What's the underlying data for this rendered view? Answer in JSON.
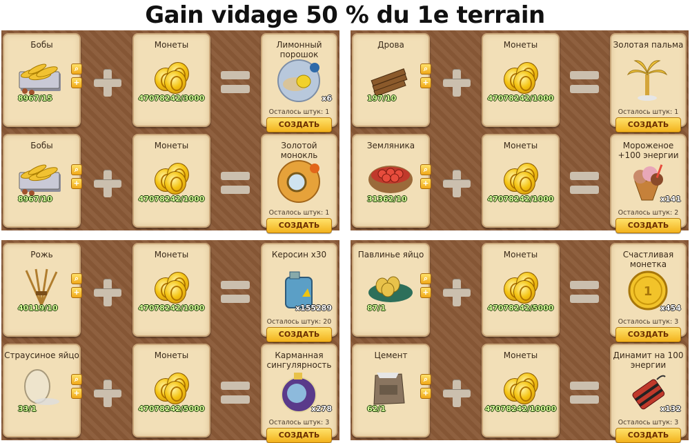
{
  "title": "Gain vidage 50 % du 1e terrain",
  "button_label": "СОЗДАТЬ",
  "panels": [
    {
      "rows": [
        {
          "ingredient": {
            "name": "Бобы",
            "count": "8967/15",
            "icon": "beans-icon"
          },
          "coins": {
            "name": "Монеты",
            "count": "47078242/3000"
          },
          "result": {
            "name": "Лимонный порошок",
            "remaining": "Осталось штук: 1",
            "qty": "x6",
            "icon": "lemon-powder-icon"
          }
        },
        {
          "ingredient": {
            "name": "Бобы",
            "count": "8967/10",
            "icon": "beans-icon"
          },
          "coins": {
            "name": "Монеты",
            "count": "47078242/1000"
          },
          "result": {
            "name": "Золотой монокль",
            "remaining": "Осталось штук: 1",
            "qty": "",
            "icon": "gold-monocle-icon"
          }
        }
      ]
    },
    {
      "rows": [
        {
          "ingredient": {
            "name": "Дрова",
            "count": "197/10",
            "icon": "firewood-icon"
          },
          "coins": {
            "name": "Монеты",
            "count": "47078242/1000"
          },
          "result": {
            "name": "Золотая пальма",
            "remaining": "Осталось штук: 1",
            "qty": "",
            "icon": "golden-palm-icon"
          }
        },
        {
          "ingredient": {
            "name": "Земляника",
            "count": "31362/10",
            "icon": "strawberry-basket-icon"
          },
          "coins": {
            "name": "Монеты",
            "count": "47078242/1000"
          },
          "result": {
            "name": "Мороженое +100 энергии",
            "remaining": "Осталось штук: 2",
            "qty": "x141",
            "icon": "ice-cream-icon"
          }
        }
      ]
    },
    {
      "rows": [
        {
          "ingredient": {
            "name": "Рожь",
            "count": "40119/10",
            "icon": "rye-icon"
          },
          "coins": {
            "name": "Монеты",
            "count": "47078242/1000"
          },
          "result": {
            "name": "Керосин x30",
            "remaining": "Осталось штук: 20",
            "qty": "x155289",
            "icon": "kerosene-can-icon"
          }
        },
        {
          "ingredient": {
            "name": "Страусиное яйцо",
            "count": "33/1",
            "icon": "ostrich-egg-icon"
          },
          "coins": {
            "name": "Монеты",
            "count": "47078242/5000"
          },
          "result": {
            "name": "Карманная сингулярность",
            "remaining": "Осталось штук: 3",
            "qty": "x278",
            "icon": "pocket-singularity-icon"
          }
        }
      ]
    },
    {
      "rows": [
        {
          "ingredient": {
            "name": "Павлинье яйцо",
            "count": "87/1",
            "icon": "peacock-egg-nest-icon"
          },
          "coins": {
            "name": "Монеты",
            "count": "47078242/5000"
          },
          "result": {
            "name": "Счастливая монетка",
            "remaining": "Осталось штук: 3",
            "qty": "x454",
            "icon": "lucky-coin-icon"
          }
        },
        {
          "ingredient": {
            "name": "Цемент",
            "count": "62/1",
            "icon": "cement-bag-icon"
          },
          "coins": {
            "name": "Монеты",
            "count": "47078242/10000"
          },
          "result": {
            "name": "Динамит на 100 энергии",
            "remaining": "Осталось штук: 3",
            "qty": "x132",
            "icon": "dynamite-icon"
          }
        }
      ]
    }
  ]
}
